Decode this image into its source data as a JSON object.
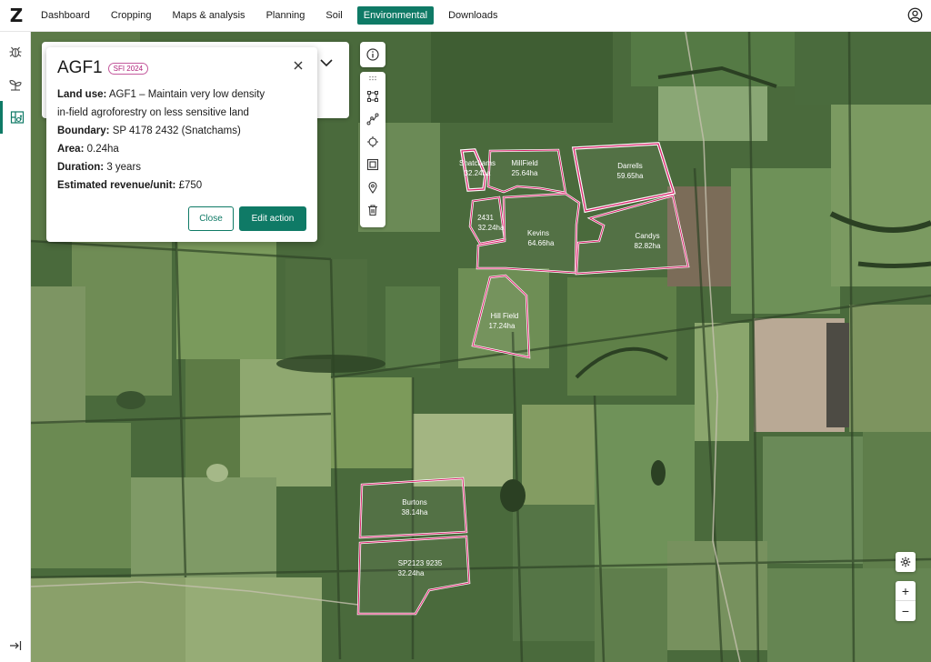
{
  "app": {
    "logo_text": "Z"
  },
  "nav": {
    "items": [
      {
        "label": "Dashboard",
        "active": false
      },
      {
        "label": "Cropping",
        "active": false
      },
      {
        "label": "Maps & analysis",
        "active": false
      },
      {
        "label": "Planning",
        "active": false
      },
      {
        "label": "Soil",
        "active": false
      },
      {
        "label": "Environmental",
        "active": true
      },
      {
        "label": "Downloads",
        "active": false
      }
    ],
    "user_icon": "user-circle-icon"
  },
  "rail": {
    "items": [
      {
        "icon": "bug-icon",
        "active": false
      },
      {
        "icon": "sprout-icon",
        "active": false
      },
      {
        "icon": "environmental-grid-icon",
        "active": true
      }
    ],
    "collapse_icon": "collapse-arrow-icon"
  },
  "popup": {
    "title": "AGF1",
    "badge": "SFI 2024",
    "land_use_label": "Land use:",
    "land_use_value": "AGF1 – Maintain very low density",
    "land_use_value_2": "in-field agroforestry on less sensitive land",
    "boundary_label": "Boundary:",
    "boundary_value": "SP 4178 2432 (Snatchams)",
    "area_label": "Area:",
    "area_value": "0.24ha",
    "duration_label": "Duration:",
    "duration_value": "3 years",
    "revenue_label": "Estimated revenue/unit:",
    "revenue_value": "£750",
    "close_label": "Close",
    "edit_label": "Edit action"
  },
  "toolbar": {
    "tools": [
      "info-icon",
      "grip-icon",
      "select-vertices-icon",
      "draw-line-icon",
      "move-icon",
      "square-select-icon",
      "location-pin-icon",
      "trash-icon"
    ]
  },
  "map_controls": {
    "settings_icon": "gear-icon",
    "zoom_in": "+",
    "zoom_out": "−"
  },
  "fields": [
    {
      "name": "Snatchams",
      "area": "32.24ha",
      "highlight": true
    },
    {
      "name": "MillField",
      "area": "25.64ha",
      "highlight": false
    },
    {
      "name": "Darrells",
      "area": "59.65ha",
      "highlight": true
    },
    {
      "name": "2431",
      "area": "32.24ha",
      "highlight": false
    },
    {
      "name": "Kevins",
      "area": "64.66ha",
      "highlight": false
    },
    {
      "name": "Candys",
      "area": "82.82ha",
      "highlight": false
    },
    {
      "name": "Hill Field",
      "area": "17.24ha",
      "highlight": false
    },
    {
      "name": "Burtons",
      "area": "38.14ha",
      "highlight": false
    },
    {
      "name": "SP2123 9235",
      "area": "32.24ha",
      "highlight": false
    }
  ],
  "colors": {
    "accent": "#0f7a66",
    "field_outline": "#ffffff",
    "field_highlight": "#d9236b",
    "badge": "#b01f7a"
  }
}
